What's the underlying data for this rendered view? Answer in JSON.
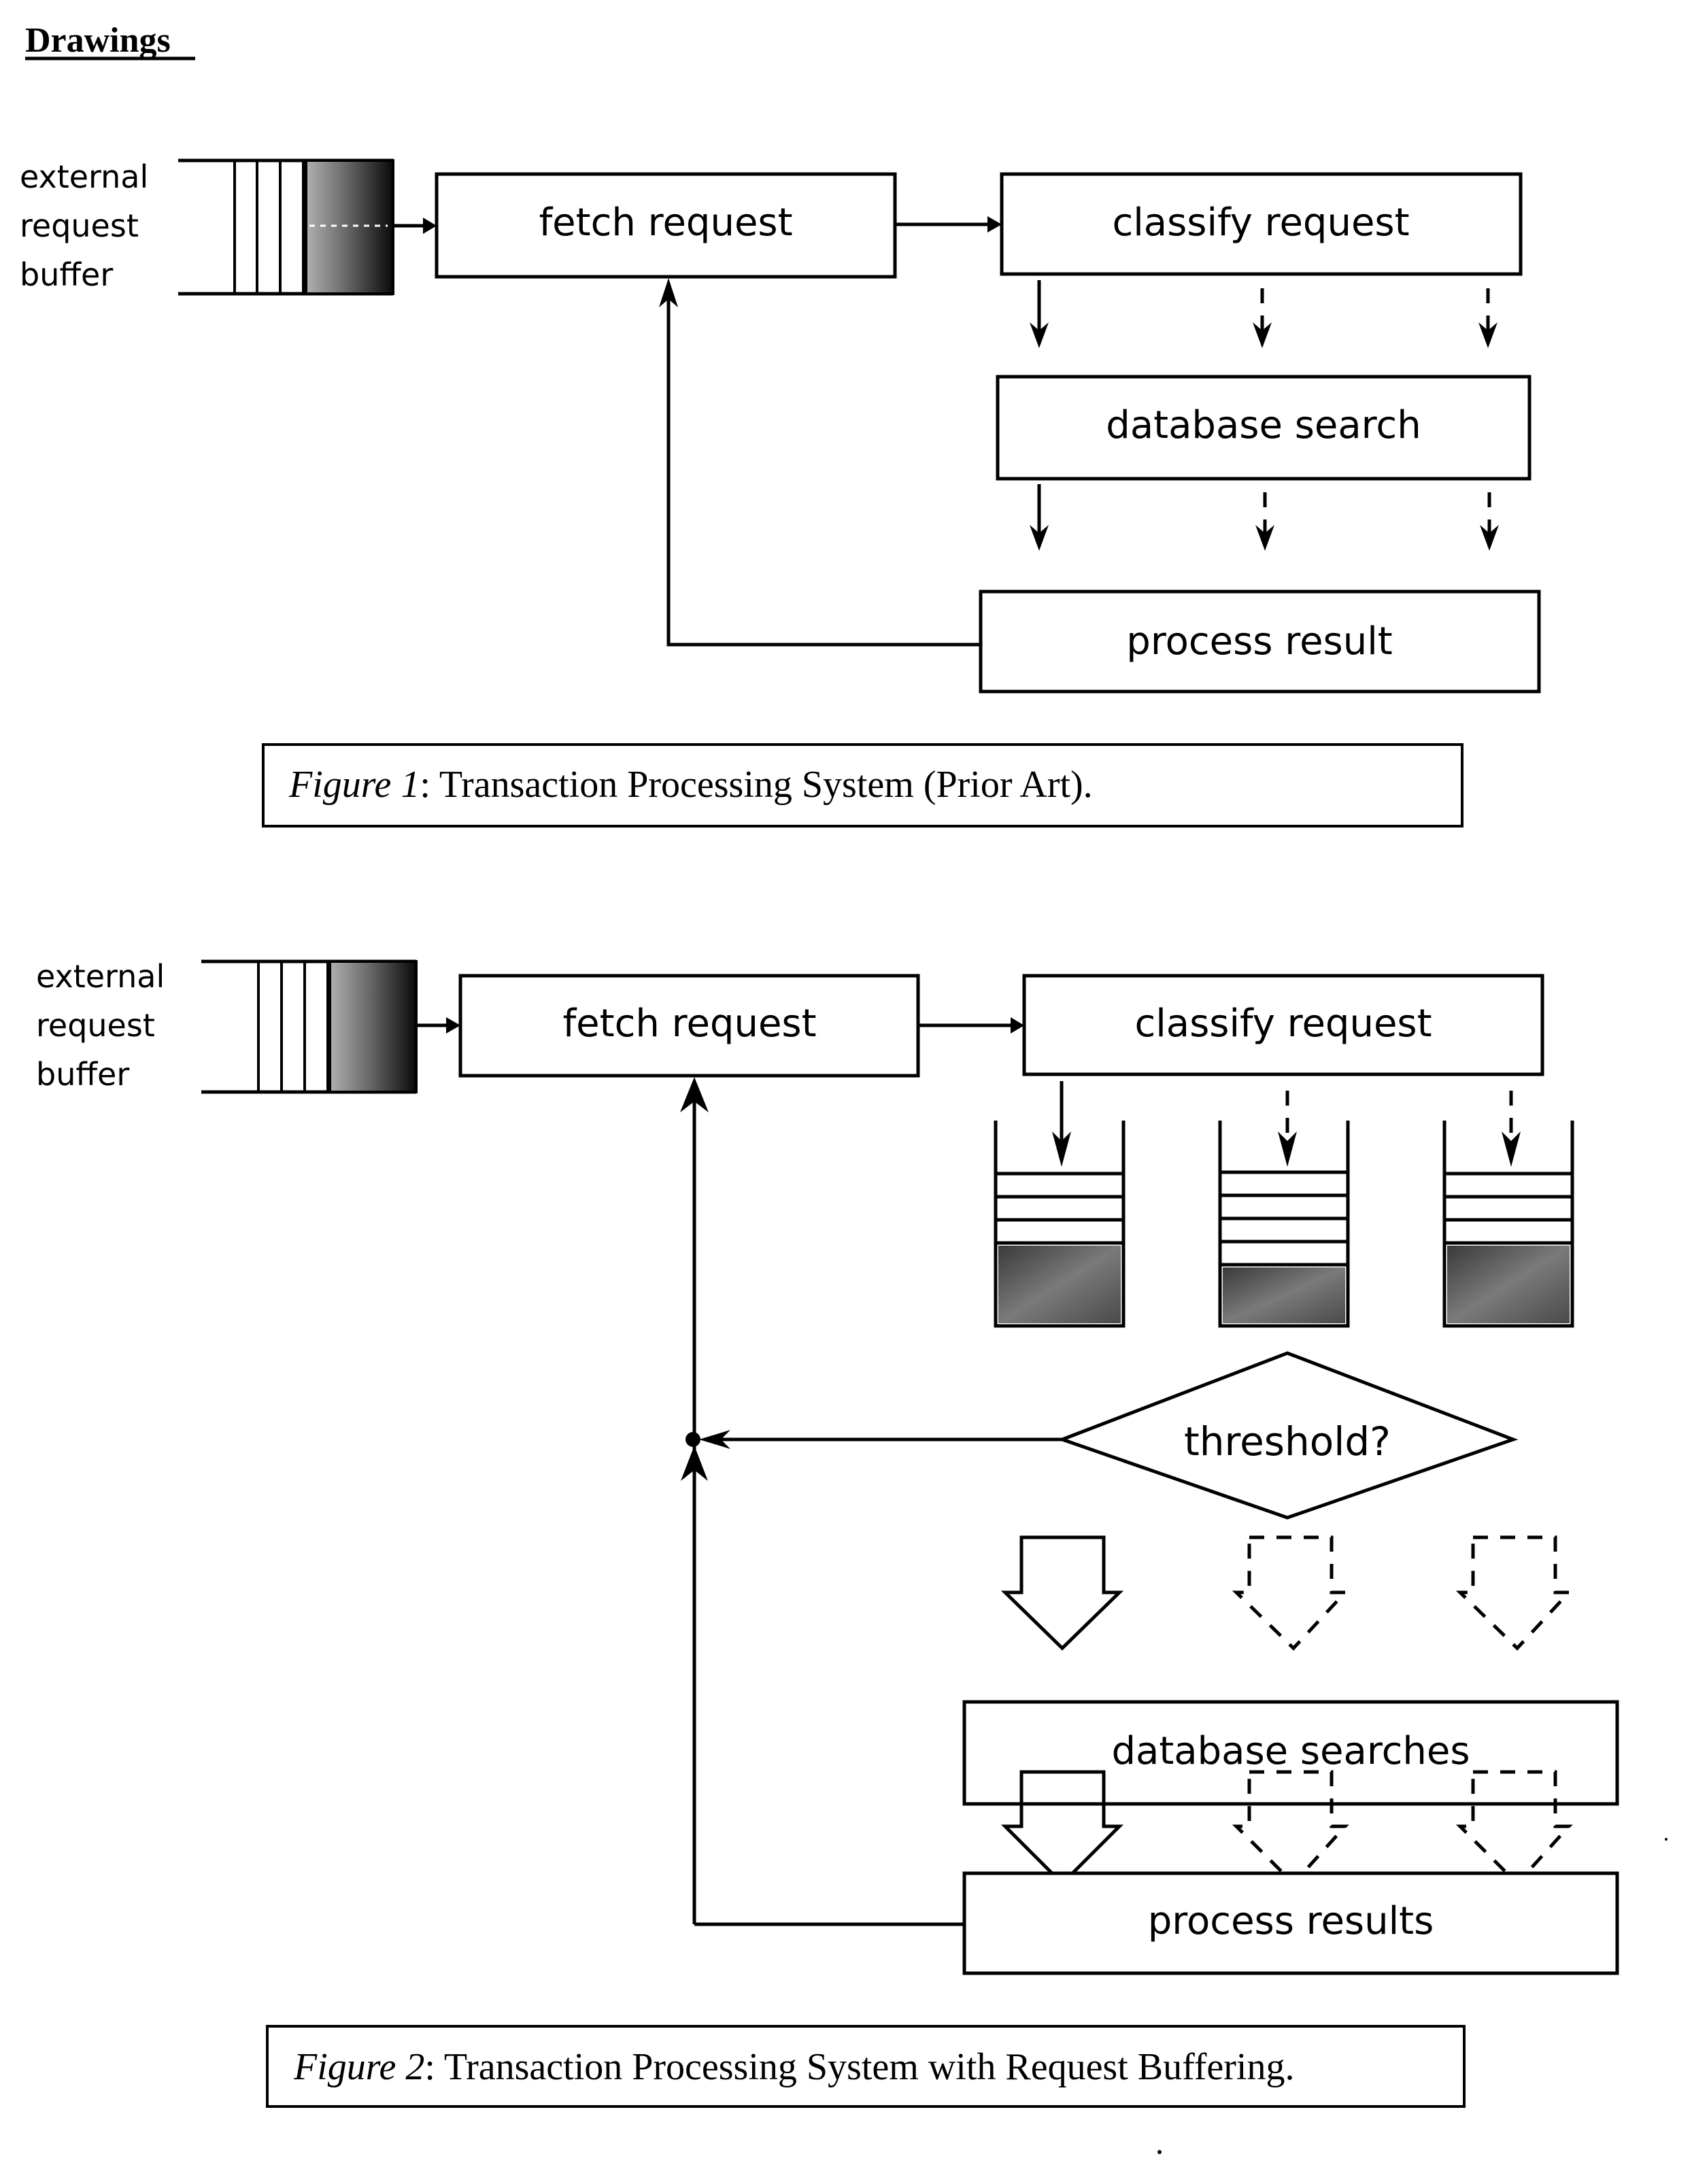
{
  "heading": "Drawings",
  "figure1": {
    "buffer_label": [
      "external",
      "request",
      "buffer"
    ],
    "fetch": "fetch  request",
    "classify": "classify request",
    "search": "database search",
    "process": "process result",
    "caption_fig": "Figure 1",
    "caption_text": ": Transaction Processing System (Prior Art)."
  },
  "figure2": {
    "buffer_label": [
      "external",
      "request",
      "buffer"
    ],
    "fetch": "fetch request",
    "classify": "classify request",
    "queues": [
      {
        "empty_slots": 3,
        "filled": true
      },
      {
        "empty_slots": 4,
        "filled": true
      },
      {
        "empty_slots": 3,
        "filled": true
      }
    ],
    "decision": "threshold?",
    "search": "database searches",
    "process": "process results",
    "caption_fig": "Figure 2",
    "caption_text": ": Transaction Processing System with Request Buffering."
  },
  "colors": {
    "ink": "#000000",
    "paper": "#ffffff",
    "shade_light": "#9a9a9a",
    "shade_dark": "#1a1a1a"
  }
}
